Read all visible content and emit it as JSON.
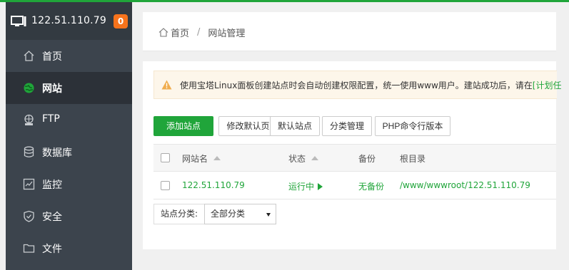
{
  "sidebar": {
    "server_ip": "122.51.110.79",
    "badge_count": "0",
    "items": [
      {
        "label": "首页",
        "icon": "home-icon"
      },
      {
        "label": "网站",
        "icon": "globe-icon",
        "active": true
      },
      {
        "label": "FTP",
        "icon": "ftp-icon"
      },
      {
        "label": "数据库",
        "icon": "database-icon"
      },
      {
        "label": "监控",
        "icon": "monitor-chart-icon"
      },
      {
        "label": "安全",
        "icon": "shield-icon"
      },
      {
        "label": "文件",
        "icon": "folder-icon"
      }
    ]
  },
  "breadcrumb": {
    "home": "首页",
    "separator": "/",
    "current": "网站管理"
  },
  "notice": {
    "text": "使用宝塔Linux面板创建站点时会自动创建权限配置，统一使用www用户。建站成功后，请在",
    "link_text": "[计划任"
  },
  "toolbar": {
    "add_site": "添加站点",
    "modify_default_page": "修改默认页",
    "default_site": "默认站点",
    "category_manage": "分类管理",
    "php_cli_version": "PHP命令行版本"
  },
  "table": {
    "headers": {
      "name": "网站名",
      "status": "状态",
      "backup": "备份",
      "root": "根目录"
    },
    "rows": [
      {
        "name": "122.51.110.79",
        "status": "运行中",
        "backup": "无备份",
        "root": "/www/wwwroot/122.51.110.79"
      }
    ]
  },
  "filter": {
    "label": "站点分类:",
    "selected": "全部分类"
  },
  "colors": {
    "accent": "#20a53a",
    "sidebar": "#3c444d",
    "badge": "#f7731c"
  }
}
